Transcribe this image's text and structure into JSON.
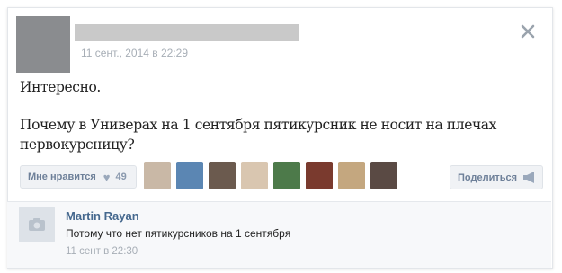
{
  "post": {
    "date": "11 сент., 2014 в 22:29",
    "text_line1": "Интересно.",
    "text_line2": "Почему в Универах на 1 сентября пятикурсник не носит на плечах",
    "text_line3": "первокурсницу?"
  },
  "actions": {
    "like_label": "Мне нравится",
    "like_count": "49",
    "share_label": "Поделиться"
  },
  "likers": [
    {
      "name": "liker-1",
      "color": "#c9b8a6"
    },
    {
      "name": "liker-2",
      "color": "#5b86b3"
    },
    {
      "name": "liker-3",
      "color": "#6b5a4e"
    },
    {
      "name": "liker-4",
      "color": "#d9c6b0"
    },
    {
      "name": "liker-5",
      "color": "#4d7a4a"
    },
    {
      "name": "liker-6",
      "color": "#7a3a2e"
    },
    {
      "name": "liker-7",
      "color": "#c4a77f"
    },
    {
      "name": "liker-8",
      "color": "#5a4a44"
    }
  ],
  "comment": {
    "author": "Martin Rayan",
    "text": "Потому что нет пятикурсников на 1 сентября",
    "date": "11 сент в 22:30"
  },
  "colors": {
    "link": "#45688e",
    "muted": "#a7aeb6",
    "button_bg": "#f0f2f5"
  },
  "icons": {
    "close": "close-icon",
    "heart": "heart-icon",
    "share": "megaphone-icon",
    "camera": "camera-icon"
  }
}
